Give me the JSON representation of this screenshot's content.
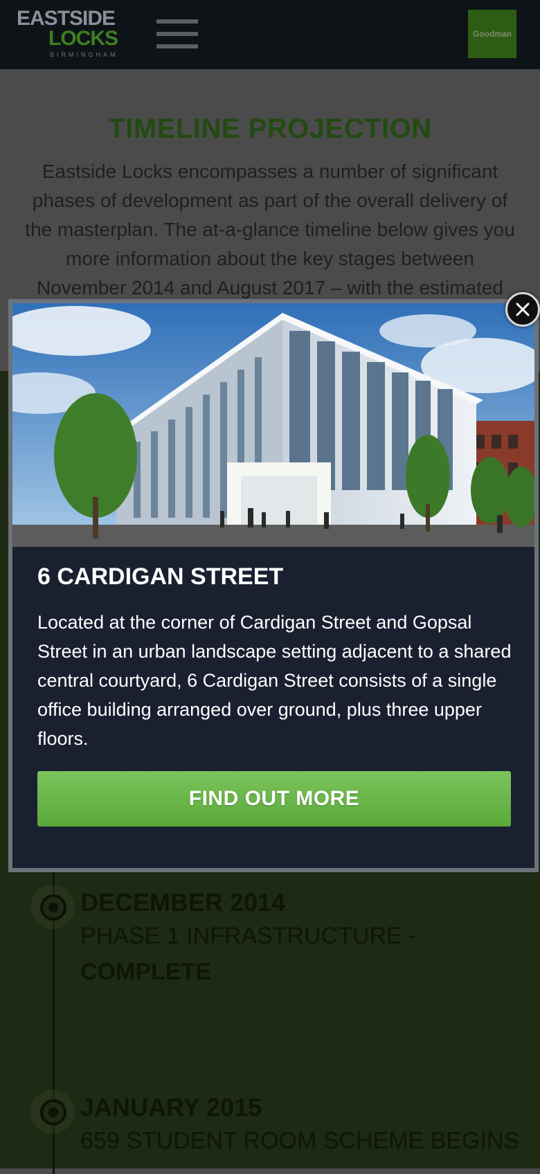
{
  "header": {
    "logo_line1": "EASTSIDE",
    "logo_line2": "LOCKS",
    "logo_line3": "BIRMINGHAM",
    "brand_text": "Goodman"
  },
  "intro": {
    "title": "TIMELINE PROJECTION",
    "text": "Eastside Locks encompasses a number of significant phases of development as part of the overall delivery of the masterplan. The at-a-glance timeline below gives you more information about the key stages between November 2014 and August 2017 – with the estimated"
  },
  "timeline": [
    {
      "date": "DECEMBER 2014",
      "description": "PHASE 1 INFRASTRUCTURE -",
      "status": "COMPLETE"
    },
    {
      "date": "JANUARY 2015",
      "description": "659 STUDENT ROOM SCHEME BEGINS",
      "status": ""
    }
  ],
  "modal": {
    "heading": "6 CARDIGAN STREET",
    "text": "Located at the corner of Cardigan Street and Gopsal Street in an urban landscape setting adjacent to a shared central courtyard, 6 Cardigan Street consists of a single office building arranged over ground, plus three upper floors.",
    "button_label": "FIND OUT MORE",
    "image_icon": "building-photo",
    "close_icon": "close-icon"
  },
  "colors": {
    "accent_green": "#6ab94a",
    "modal_bg": "#1a2030",
    "header_bg": "#0e1318"
  }
}
